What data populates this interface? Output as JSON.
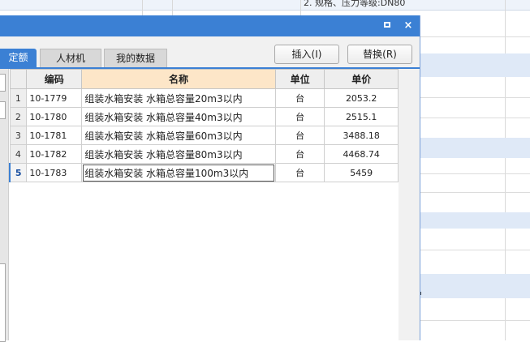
{
  "background": {
    "top_cell_text": "2. 规格、压力等级:DN80"
  },
  "dialog": {
    "controls": {
      "maximize_icon": "maximize-icon",
      "close_glyph": "×"
    },
    "tabs": [
      {
        "label": "定额",
        "active": true
      },
      {
        "label": "人材机",
        "active": false
      },
      {
        "label": "我的数据",
        "active": false
      }
    ],
    "buttons": {
      "insert": "插入(I)",
      "replace": "替换(R)"
    },
    "table": {
      "headers": {
        "rownum": "",
        "code": "编码",
        "name": "名称",
        "unit": "单位",
        "price": "单价"
      },
      "rows": [
        {
          "num": "1",
          "code": "10-1779",
          "name": "组装水箱安装 水箱总容量20m3以内",
          "unit": "台",
          "price": "2053.2"
        },
        {
          "num": "2",
          "code": "10-1780",
          "name": "组装水箱安装 水箱总容量40m3以内",
          "unit": "台",
          "price": "2515.1"
        },
        {
          "num": "3",
          "code": "10-1781",
          "name": "组装水箱安装 水箱总容量60m3以内",
          "unit": "台",
          "price": "3488.18"
        },
        {
          "num": "4",
          "code": "10-1782",
          "name": "组装水箱安装 水箱总容量80m3以内",
          "unit": "台",
          "price": "4468.74"
        },
        {
          "num": "5",
          "code": "10-1783",
          "name": "组装水箱安装 水箱总容量100m3以内",
          "unit": "台",
          "price": "5459"
        }
      ],
      "selected_row": 5
    }
  },
  "colors": {
    "accent": "#3b80d4",
    "header_sorted": "#fde6c8",
    "band": "#dfe9f7"
  }
}
